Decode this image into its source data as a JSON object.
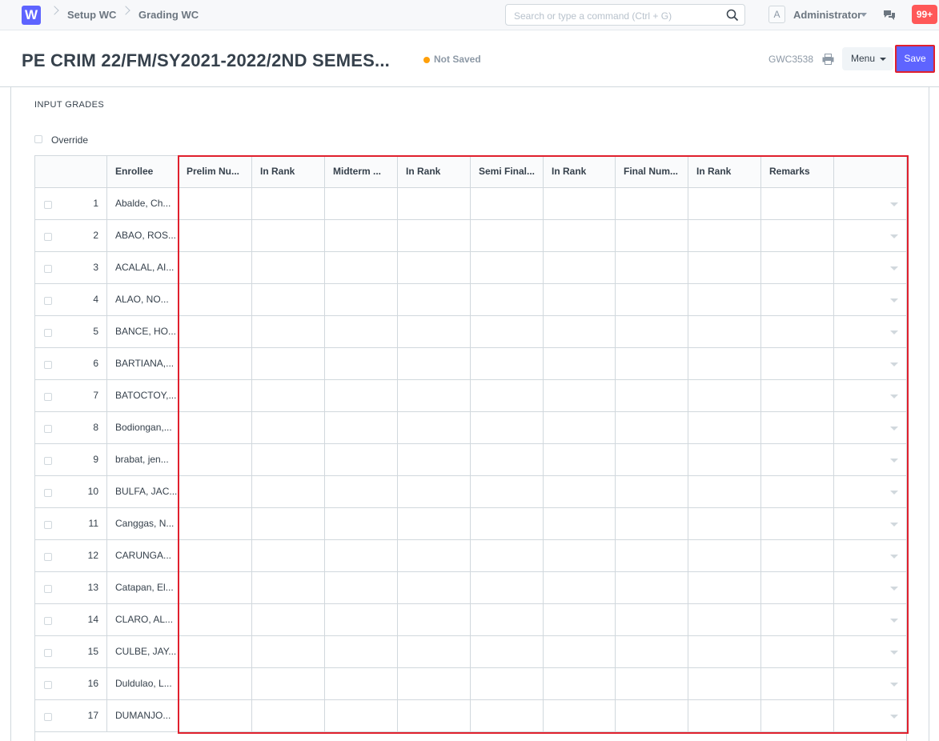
{
  "navbar": {
    "logo": "W",
    "breadcrumbs": [
      "Setup WC",
      "Grading WC"
    ],
    "search_placeholder": "Search or type a command (Ctrl + G)",
    "avatar_letter": "A",
    "user": "Administrator",
    "notifications": "99+"
  },
  "page": {
    "title": "PE CRIM 22/FM/SY2021-2022/2ND SEMES...",
    "status": "Not Saved",
    "status_color": "#ffa00a",
    "doc_id": "GWC3538",
    "menu_label": "Menu",
    "save_label": "Save"
  },
  "form": {
    "section_title": "INPUT GRADES",
    "override_label": "Override"
  },
  "grid": {
    "columns": [
      "Enrollee",
      "Prelim Nu...",
      "In Rank",
      "Midterm ...",
      "In Rank",
      "Semi Final...",
      "In Rank",
      "Final Num...",
      "In Rank",
      "Remarks"
    ],
    "rows": [
      {
        "idx": "1",
        "enrollee": "Abalde, Ch..."
      },
      {
        "idx": "2",
        "enrollee": "ABAO, ROS..."
      },
      {
        "idx": "3",
        "enrollee": "ACALAL, AI..."
      },
      {
        "idx": "4",
        "enrollee": "ALAO, NO..."
      },
      {
        "idx": "5",
        "enrollee": "BANCE, HO..."
      },
      {
        "idx": "6",
        "enrollee": "BARTIANA,..."
      },
      {
        "idx": "7",
        "enrollee": "BATOCTOY,..."
      },
      {
        "idx": "8",
        "enrollee": "Bodiongan,..."
      },
      {
        "idx": "9",
        "enrollee": "brabat, jen..."
      },
      {
        "idx": "10",
        "enrollee": "BULFA, JAC..."
      },
      {
        "idx": "11",
        "enrollee": "Canggas, N..."
      },
      {
        "idx": "12",
        "enrollee": "CARUNGA..."
      },
      {
        "idx": "13",
        "enrollee": "Catapan, El..."
      },
      {
        "idx": "14",
        "enrollee": "CLARO, AL..."
      },
      {
        "idx": "15",
        "enrollee": "CULBE, JAY..."
      },
      {
        "idx": "16",
        "enrollee": "Duldulao, L..."
      },
      {
        "idx": "17",
        "enrollee": "DUMANJO..."
      }
    ]
  }
}
